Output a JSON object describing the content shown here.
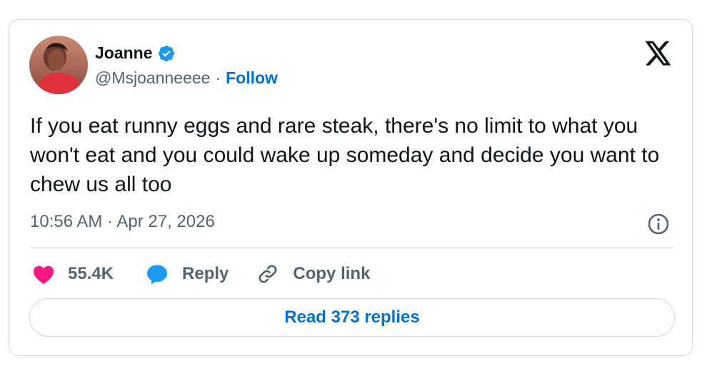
{
  "author": {
    "display_name": "Joanne",
    "handle": "@Msjoanneeee",
    "separator": "·",
    "follow_label": "Follow",
    "verified": true,
    "avatar_icon": "profile-photo"
  },
  "tweet": {
    "text": "If you eat runny eggs and rare steak, there's no limit to what you won't eat and you could wake up someday and decide you want to chew us all too",
    "timestamp": "10:56 AM · Apr 27, 2026"
  },
  "actions": {
    "likes": "55.4K",
    "reply_label": "Reply",
    "copy_link_label": "Copy link"
  },
  "read_replies_label": "Read 373 replies",
  "colors": {
    "accent": "#006fd6",
    "verified": "#1d9bf0",
    "like": "#f91880",
    "reply": "#1d9bf0",
    "text": "#0f1419",
    "muted": "#536471",
    "border": "#cfd9de"
  },
  "icons": {
    "logo": "x-logo-icon",
    "verified": "verified-badge-icon",
    "info": "info-icon",
    "like": "heart-icon",
    "reply": "speech-bubble-icon",
    "copy": "link-icon"
  }
}
